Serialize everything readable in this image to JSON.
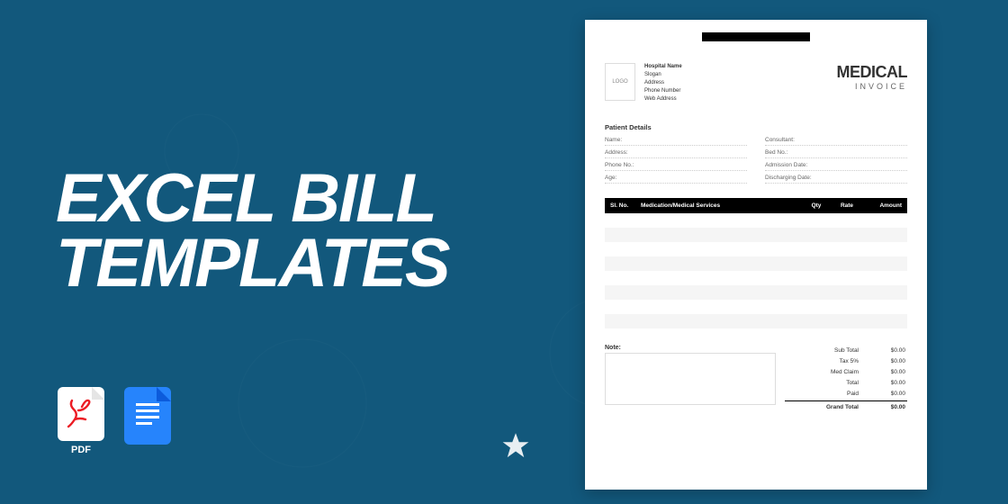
{
  "title": {
    "line1": "EXCEL BILL",
    "line2": "TEMPLATES"
  },
  "icons": {
    "pdf_label": "PDF",
    "docs_label": ""
  },
  "invoice": {
    "logo_text": "LOGO",
    "hospital": {
      "name": "Hospital Name",
      "slogan": "Slogan",
      "address": "Address",
      "phone": "Phone Number",
      "web": "Web Address"
    },
    "doc_title": "MEDICAL",
    "doc_subtitle": "INVOICE",
    "patient_section": "Patient Details",
    "patient_fields_left": [
      "Name:",
      "Address:",
      "Phone No.:",
      "Age:"
    ],
    "patient_fields_right": [
      "Consultant:",
      "Bed No.:",
      "Admission Date:",
      "Discharging Date:"
    ],
    "table_headers": {
      "sl": "Sl. No.",
      "service": "Medication/Medical Services",
      "qty": "Qty",
      "rate": "Rate",
      "amount": "Amount"
    },
    "note_label": "Note:",
    "totals": [
      {
        "label": "Sub Total",
        "value": "$0.00"
      },
      {
        "label": "Tax 5%",
        "value": "$0.00"
      },
      {
        "label": "Med Claim",
        "value": "$0.00"
      },
      {
        "label": "Total",
        "value": "$0.00"
      },
      {
        "label": "Paid",
        "value": "$0.00"
      }
    ],
    "grand_total_label": "Grand Total",
    "grand_total_value": "$0.00"
  }
}
